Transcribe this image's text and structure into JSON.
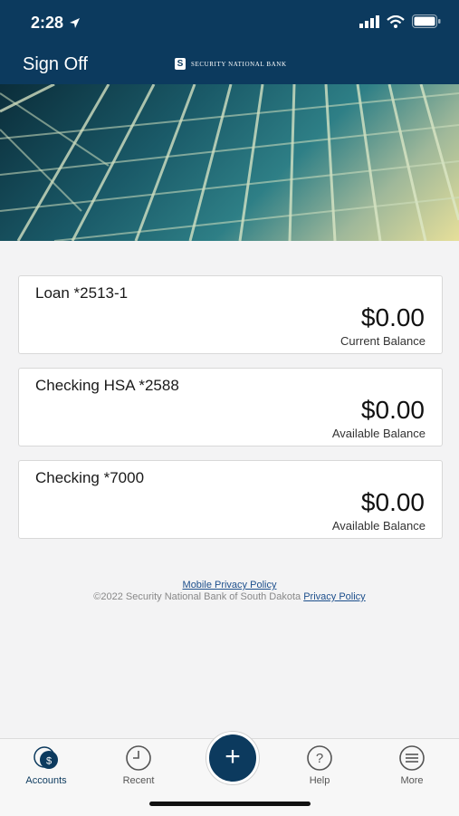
{
  "status_bar": {
    "time": "2:28"
  },
  "nav": {
    "sign_off": "Sign Off",
    "brand_name": "SECURITY NATIONAL BANK",
    "brand_mark": "S"
  },
  "accounts": [
    {
      "name": "Loan *2513-1",
      "amount": "$0.00",
      "caption": "Current Balance"
    },
    {
      "name": "Checking HSA *2588",
      "amount": "$0.00",
      "caption": "Available Balance"
    },
    {
      "name": "Checking *7000",
      "amount": "$0.00",
      "caption": "Available Balance"
    }
  ],
  "footer": {
    "mobile_privacy": "Mobile Privacy Policy",
    "copyright": "©2022 Security National Bank of South Dakota",
    "privacy": "Privacy Policy"
  },
  "tabbar": {
    "accounts": "Accounts",
    "recent": "Recent",
    "add": "+",
    "help": "Help",
    "more": "More"
  },
  "colors": {
    "primary": "#0c3a5e",
    "background": "#f3f3f4"
  }
}
